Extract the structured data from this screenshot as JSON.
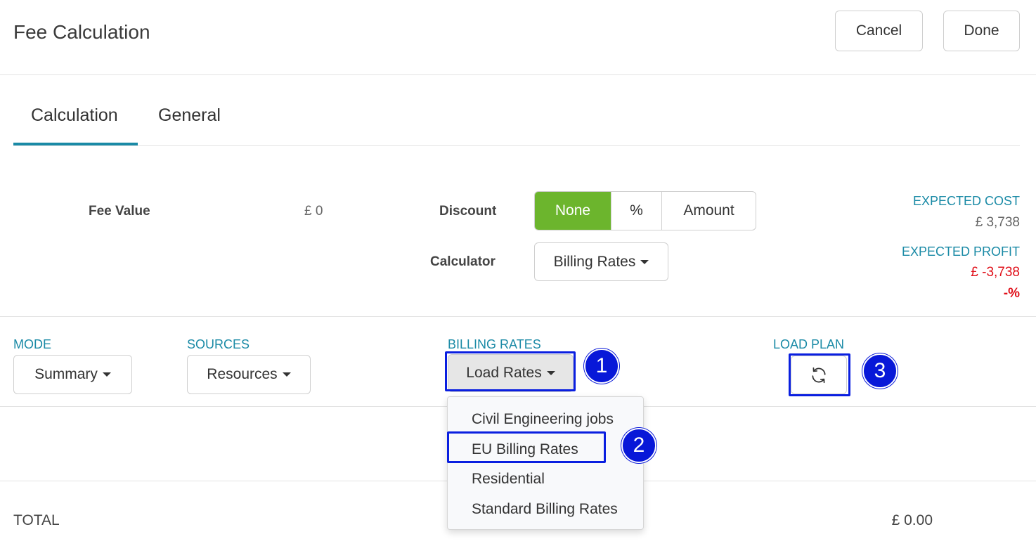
{
  "header": {
    "title": "Fee Calculation",
    "cancel_label": "Cancel",
    "done_label": "Done"
  },
  "tabs": [
    {
      "label": "Calculation",
      "active": true
    },
    {
      "label": "General",
      "active": false
    }
  ],
  "fee": {
    "label": "Fee Value",
    "value": "£ 0"
  },
  "discount": {
    "label": "Discount",
    "options": [
      "None",
      "%",
      "Amount"
    ],
    "selected": "None"
  },
  "calculator": {
    "label": "Calculator",
    "value": "Billing Rates"
  },
  "expected": {
    "cost_label": "EXPECTED COST",
    "cost_value": "£ 3,738",
    "profit_label": "EXPECTED PROFIT",
    "profit_value": "£ -3,738",
    "profit_pct": "-%"
  },
  "toolbar": {
    "mode_label": "MODE",
    "mode_value": "Summary",
    "sources_label": "SOURCES",
    "sources_value": "Resources",
    "billing_label": "BILLING RATES",
    "billing_value": "Load Rates",
    "load_plan_label": "LOAD PLAN"
  },
  "dropdown": {
    "items": [
      "Civil Engineering jobs",
      "EU Billing Rates",
      "Residential",
      "Standard Billing Rates"
    ]
  },
  "total": {
    "label": "TOTAL",
    "value": "£ 0.00"
  },
  "callouts": [
    "1",
    "2",
    "3"
  ],
  "colors": {
    "accent": "#1a8aa6",
    "active_green": "#6cb52d",
    "negative": "#e0101a",
    "callout": "#0818d8"
  },
  "icons": {
    "refresh": "refresh-icon",
    "caret": "caret-down-icon"
  }
}
